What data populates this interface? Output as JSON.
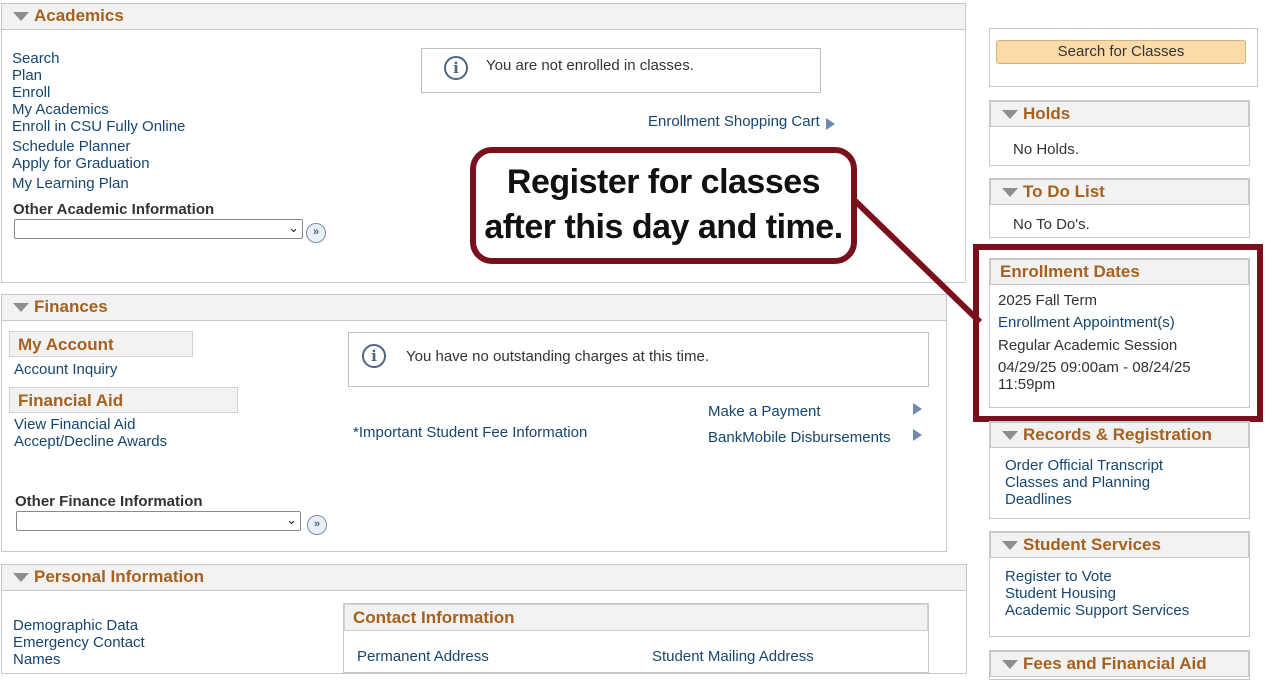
{
  "academics": {
    "title": "Academics",
    "links": [
      "Search",
      "Plan",
      "Enroll",
      "My Academics",
      "Enroll in CSU Fully Online",
      "Schedule Planner",
      "Apply for Graduation",
      "My Learning Plan"
    ],
    "other_label": "Other Academic Information",
    "info_message": "You are not enrolled in classes.",
    "shopping_cart": "Enrollment Shopping Cart"
  },
  "callout": {
    "line1": "Register for classes",
    "line2": "after this day and time."
  },
  "finances": {
    "title": "Finances",
    "my_account": "My Account",
    "account_inquiry": "Account Inquiry",
    "financial_aid": "Financial Aid",
    "view_aid": "View Financial Aid",
    "accept_awards": "Accept/Decline Awards",
    "other_label": "Other Finance Information",
    "info_message": "You have no outstanding charges at this time.",
    "fee_info": "*Important Student Fee Information",
    "make_payment": "Make a Payment",
    "bankmobile": "BankMobile Disbursements"
  },
  "personal": {
    "title": "Personal Information",
    "links": [
      "Demographic Data",
      "Emergency Contact",
      "Names"
    ],
    "contact_title": "Contact Information",
    "permanent_address": "Permanent Address",
    "mailing_address": "Student Mailing Address"
  },
  "sidebar": {
    "search_button": "Search for Classes",
    "holds_title": "Holds",
    "holds_text": "No Holds.",
    "todo_title": "To Do List",
    "todo_text": "No To Do's.",
    "enroll_title": "Enrollment Dates",
    "term": "2025 Fall Term",
    "appointment_link": "Enrollment Appointment(s)",
    "session": "Regular Academic Session",
    "dates_line1": "04/29/25 09:00am - 08/24/25",
    "dates_line2": "11:59pm",
    "records_title": "Records & Registration",
    "records_links": [
      "Order Official Transcript",
      "Classes and Planning",
      "Deadlines"
    ],
    "student_services_title": "Student Services",
    "services_links": [
      "Register to Vote",
      "Student Housing",
      "Academic Support Services"
    ],
    "fees_title": "Fees and Financial Aid"
  },
  "colors": {
    "accent": "#a5611d",
    "link": "#16466f",
    "highlight": "#7a0f1d"
  }
}
